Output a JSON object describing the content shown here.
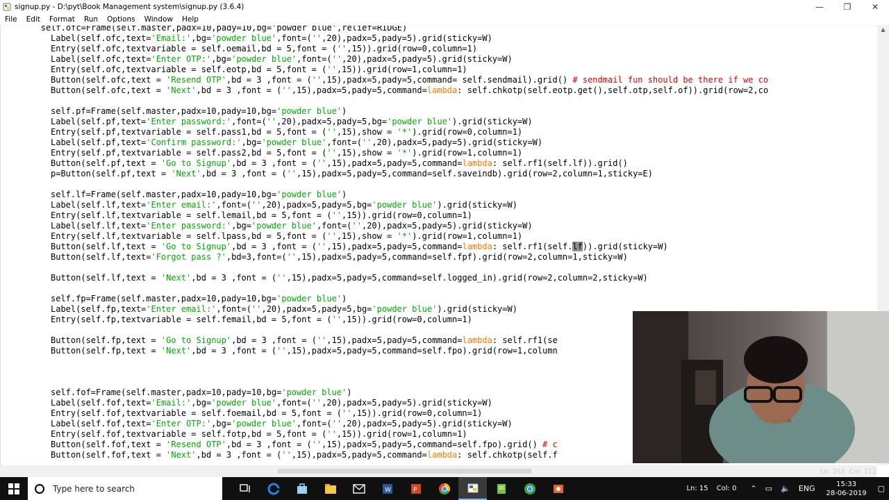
{
  "window": {
    "title": "signup.py - D:\\pyt\\Book Management system\\signup.py (3.6.4)",
    "minimize": "—",
    "maximize": "❐",
    "close": "✕"
  },
  "menu": [
    "File",
    "Edit",
    "Format",
    "Run",
    "Options",
    "Window",
    "Help"
  ],
  "code_lines": [
    [
      [
        "t",
        "        self.ofc=Frame(self.master,padx=10,pady=10,bg='powder blue',relief=RIDGE)"
      ]
    ],
    [
      [
        "t",
        "Label(self.ofc,text="
      ],
      [
        "s",
        "'Email:'"
      ],
      [
        "t",
        ",bg="
      ],
      [
        "s",
        "'powder blue'"
      ],
      [
        "t",
        ",font=("
      ],
      [
        "s",
        "''"
      ],
      [
        "t",
        ",20),padx=5,pady=5).grid(sticky=W)"
      ]
    ],
    [
      [
        "t",
        "Entry(self.ofc,textvariable = self.oemail,bd = 5,font = ("
      ],
      [
        "s",
        "''"
      ],
      [
        "t",
        ",15)).grid(row=0,column=1)"
      ]
    ],
    [
      [
        "t",
        "Label(self.ofc,text="
      ],
      [
        "s",
        "'Enter OTP:'"
      ],
      [
        "t",
        ",bg="
      ],
      [
        "s",
        "'powder blue'"
      ],
      [
        "t",
        ",font=("
      ],
      [
        "s",
        "''"
      ],
      [
        "t",
        ",20),padx=5,pady=5).grid(sticky=W)"
      ]
    ],
    [
      [
        "t",
        "Entry(self.ofc,textvariable = self.eotp,bd = 5,font = ("
      ],
      [
        "s",
        "''"
      ],
      [
        "t",
        ",15)).grid(row=1,column=1)"
      ]
    ],
    [
      [
        "t",
        "Button(self.ofc,text = "
      ],
      [
        "s",
        "'Resend OTP'"
      ],
      [
        "t",
        ",bd = 3 ,font = ("
      ],
      [
        "s",
        "''"
      ],
      [
        "t",
        ",15),padx=5,pady=5,command= self.sendmail).grid() "
      ],
      [
        "c",
        "# sendmail fun should be there if we co"
      ]
    ],
    [
      [
        "t",
        "Button(self.ofc,text = "
      ],
      [
        "s",
        "'Next'"
      ],
      [
        "t",
        ",bd = 3 ,font = ("
      ],
      [
        "s",
        "''"
      ],
      [
        "t",
        ",15),padx=5,pady=5,command="
      ],
      [
        "k",
        "lambda"
      ],
      [
        "t",
        ": self.chkotp(self.eotp.get(),self.otp,self.of)).grid(row=2,co"
      ]
    ],
    [],
    [
      [
        "t",
        "self.pf=Frame(self.master,padx=10,pady=10,bg="
      ],
      [
        "s",
        "'powder blue'"
      ],
      [
        "t",
        ")"
      ]
    ],
    [
      [
        "t",
        "Label(self.pf,text="
      ],
      [
        "s",
        "'Enter password:'"
      ],
      [
        "t",
        ",font=("
      ],
      [
        "s",
        "''"
      ],
      [
        "t",
        ",20),padx=5,pady=5,bg="
      ],
      [
        "s",
        "'powder blue'"
      ],
      [
        "t",
        ").grid(sticky=W)"
      ]
    ],
    [
      [
        "t",
        "Entry(self.pf,textvariable = self.pass1,bd = 5,font = ("
      ],
      [
        "s",
        "''"
      ],
      [
        "t",
        ",15),show = "
      ],
      [
        "s",
        "'*'"
      ],
      [
        "t",
        ").grid(row=0,column=1)"
      ]
    ],
    [
      [
        "t",
        "Label(self.pf,text="
      ],
      [
        "s",
        "'Confirm password:'"
      ],
      [
        "t",
        ",bg="
      ],
      [
        "s",
        "'powder blue'"
      ],
      [
        "t",
        ",font=("
      ],
      [
        "s",
        "''"
      ],
      [
        "t",
        ",20),padx=5,pady=5).grid(sticky=W)"
      ]
    ],
    [
      [
        "t",
        "Entry(self.pf,textvariable = self.pass2,bd = 5,font = ("
      ],
      [
        "s",
        "''"
      ],
      [
        "t",
        ",15),show = "
      ],
      [
        "s",
        "'*'"
      ],
      [
        "t",
        ").grid(row=1,column=1)"
      ]
    ],
    [
      [
        "t",
        "Button(self.pf,text = "
      ],
      [
        "s",
        "'Go to Signup'"
      ],
      [
        "t",
        ",bd = 3 ,font = ("
      ],
      [
        "s",
        "''"
      ],
      [
        "t",
        ",15),padx=5,pady=5,command="
      ],
      [
        "k",
        "lambda"
      ],
      [
        "t",
        ": self.rf1(self.lf)).grid()"
      ]
    ],
    [
      [
        "t",
        "p=Button(self.pf,text = "
      ],
      [
        "s",
        "'Next'"
      ],
      [
        "t",
        ",bd = 3 ,font = ("
      ],
      [
        "s",
        "''"
      ],
      [
        "t",
        ",15),padx=5,pady=5,command=self.saveindb).grid(row=2,column=1,sticky=E)"
      ]
    ],
    [],
    [
      [
        "t",
        "self.lf=Frame(self.master,padx=10,pady=10,bg="
      ],
      [
        "s",
        "'powder blue'"
      ],
      [
        "t",
        ")"
      ]
    ],
    [
      [
        "t",
        "Label(self.lf,text="
      ],
      [
        "s",
        "'Enter email:'"
      ],
      [
        "t",
        ",font=("
      ],
      [
        "s",
        "''"
      ],
      [
        "t",
        ",20),padx=5,pady=5,bg="
      ],
      [
        "s",
        "'powder blue'"
      ],
      [
        "t",
        ").grid(sticky=W)"
      ]
    ],
    [
      [
        "t",
        "Entry(self.lf,textvariable = self.lemail,bd = 5,font = ("
      ],
      [
        "s",
        "''"
      ],
      [
        "t",
        ",15)).grid(row=0,column=1)"
      ]
    ],
    [
      [
        "t",
        "Label(self.lf,text="
      ],
      [
        "s",
        "'Enter password:'"
      ],
      [
        "t",
        ",bg="
      ],
      [
        "s",
        "'powder blue'"
      ],
      [
        "t",
        ",font=("
      ],
      [
        "s",
        "''"
      ],
      [
        "t",
        ",20),padx=5,pady=5).grid(sticky=W)"
      ]
    ],
    [
      [
        "t",
        "Entry(self.lf,textvariable = self.lpass,bd = 5,font = ("
      ],
      [
        "s",
        "''"
      ],
      [
        "t",
        ",15),show = "
      ],
      [
        "s",
        "'*'"
      ],
      [
        "t",
        ").grid(row=1,column=1)"
      ]
    ],
    [
      [
        "t",
        "Button(self.lf,text = "
      ],
      [
        "s",
        "'Go to Signup'"
      ],
      [
        "t",
        ",bd = 3 ,font = ("
      ],
      [
        "s",
        "''"
      ],
      [
        "t",
        ",15),padx=5,pady=5,command="
      ],
      [
        "k",
        "lambda"
      ],
      [
        "t",
        ": self.rf1(self."
      ],
      [
        "h",
        "lf"
      ],
      [
        "t",
        ")).grid(sticky=W)"
      ]
    ],
    [
      [
        "t",
        "Button(self.lf,text="
      ],
      [
        "s",
        "'Forgot pass ?'"
      ],
      [
        "t",
        ",bd=3,font=("
      ],
      [
        "s",
        "''"
      ],
      [
        "t",
        ",15),padx=5,pady=5,command=self.fpf).grid(row=2,column=1,sticky=W)"
      ]
    ],
    [],
    [
      [
        "t",
        "Button(self.lf,text = "
      ],
      [
        "s",
        "'Next'"
      ],
      [
        "t",
        ",bd = 3 ,font = ("
      ],
      [
        "s",
        "''"
      ],
      [
        "t",
        ",15),padx=5,pady=5,command=self.logged_in).grid(row=2,column=2,sticky=W)"
      ]
    ],
    [],
    [
      [
        "t",
        "self.fp=Frame(self.master,padx=10,pady=10,bg="
      ],
      [
        "s",
        "'powder blue'"
      ],
      [
        "t",
        ")"
      ]
    ],
    [
      [
        "t",
        "Label(self.fp,text="
      ],
      [
        "s",
        "'Enter email:'"
      ],
      [
        "t",
        ",font=("
      ],
      [
        "s",
        "''"
      ],
      [
        "t",
        ",20),padx=5,pady=5,bg="
      ],
      [
        "s",
        "'powder blue'"
      ],
      [
        "t",
        ").grid(sticky=W)"
      ]
    ],
    [
      [
        "t",
        "Entry(self.fp,textvariable = self.femail,bd = 5,font = ("
      ],
      [
        "s",
        "''"
      ],
      [
        "t",
        ",15)).grid(row=0,column=1)"
      ]
    ],
    [],
    [
      [
        "t",
        "Button(self.fp,text = "
      ],
      [
        "s",
        "'Go to Signup'"
      ],
      [
        "t",
        ",bd = 3 ,font = ("
      ],
      [
        "s",
        "''"
      ],
      [
        "t",
        ",15),padx=5,pady=5,command="
      ],
      [
        "k",
        "lambda"
      ],
      [
        "t",
        ": self.rf1(se"
      ]
    ],
    [
      [
        "t",
        "Button(self.fp,text = "
      ],
      [
        "s",
        "'Next'"
      ],
      [
        "t",
        ",bd = 3 ,font = ("
      ],
      [
        "s",
        "''"
      ],
      [
        "t",
        ",15),padx=5,pady=5,command=self.fpo).grid(row=1,column"
      ]
    ],
    [],
    [],
    [],
    [
      [
        "t",
        "self.fof=Frame(self.master,padx=10,pady=10,bg="
      ],
      [
        "s",
        "'powder blue'"
      ],
      [
        "t",
        ")"
      ]
    ],
    [
      [
        "t",
        "Label(self.fof,text="
      ],
      [
        "s",
        "'Email:'"
      ],
      [
        "t",
        ",bg="
      ],
      [
        "s",
        "'powder blue'"
      ],
      [
        "t",
        ",font=("
      ],
      [
        "s",
        "''"
      ],
      [
        "t",
        ",20),padx=5,pady=5).grid(sticky=W)"
      ]
    ],
    [
      [
        "t",
        "Entry(self.fof,textvariable = self.foemail,bd = 5,font = ("
      ],
      [
        "s",
        "''"
      ],
      [
        "t",
        ",15)).grid(row=0,column=1)"
      ]
    ],
    [
      [
        "t",
        "Label(self.fof,text="
      ],
      [
        "s",
        "'Enter OTP:'"
      ],
      [
        "t",
        ",bg="
      ],
      [
        "s",
        "'powder blue'"
      ],
      [
        "t",
        ",font=("
      ],
      [
        "s",
        "''"
      ],
      [
        "t",
        ",20),padx=5,pady=5).grid(sticky=W)"
      ]
    ],
    [
      [
        "t",
        "Entry(self.fof,textvariable = self.fotp,bd = 5,font = ("
      ],
      [
        "s",
        "''"
      ],
      [
        "t",
        ",15)).grid(row=1,column=1)"
      ]
    ],
    [
      [
        "t",
        "Button(self.fof,text = "
      ],
      [
        "s",
        "'Resend OTP'"
      ],
      [
        "t",
        ",bd = 3 ,font = ("
      ],
      [
        "s",
        "''"
      ],
      [
        "t",
        ",15),padx=5,pady=5,command=self.fpo).grid() "
      ],
      [
        "c",
        "# c"
      ]
    ],
    [
      [
        "t",
        "Button(self.fof,text = "
      ],
      [
        "s",
        "'Next'"
      ],
      [
        "t",
        ",bd = 3 ,font = ("
      ],
      [
        "s",
        "''"
      ],
      [
        "t",
        ",15),padx=5,pady=5,command="
      ],
      [
        "k",
        "lambda"
      ],
      [
        "t",
        ": self.chkotp(self.f"
      ]
    ]
  ],
  "status": {
    "ln": "Ln: 15",
    "col": "Col: 0",
    "ln_top": "Ln: 263",
    "col_top": "Col: 112"
  },
  "taskbar": {
    "search_placeholder": "Type here to search",
    "language": "ENG",
    "time": "15:33",
    "date": "28-06-2019"
  },
  "colors": {
    "string": "#00aa00",
    "comment": "#dd0000",
    "keyword": "#ff7700",
    "taskbar": "#101010"
  }
}
